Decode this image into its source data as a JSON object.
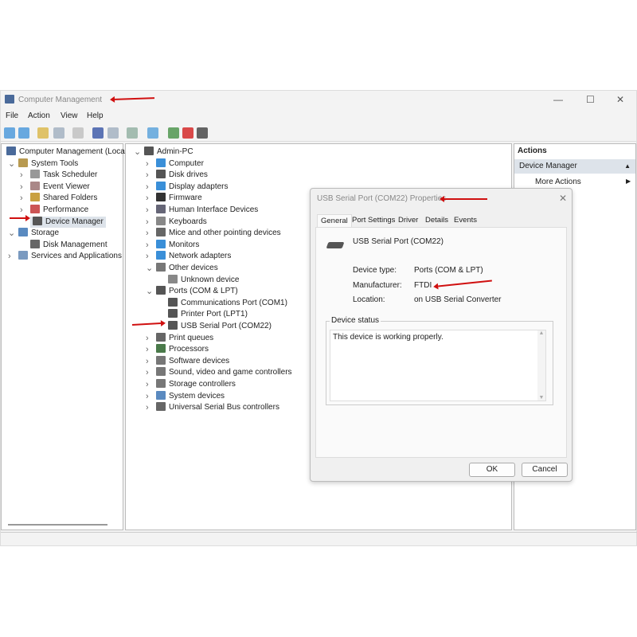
{
  "window": {
    "title": "Computer Management",
    "minimize": "—",
    "maximize": "☐",
    "close": "✕"
  },
  "menu": [
    "File",
    "Action",
    "View",
    "Help"
  ],
  "toolbar_icons": [
    "back-arrow-icon",
    "forward-arrow-icon",
    "up-folder-icon",
    "show-hide-tree-icon",
    "properties-icon",
    "help-icon",
    "show-action-pane-icon",
    "scan-hardware-icon",
    "monitor-icon",
    "enable-device-icon",
    "uninstall-icon",
    "update-driver-icon"
  ],
  "left_tree": [
    {
      "label": "Computer Management (Local",
      "level": 0,
      "chev": ""
    },
    {
      "label": "System Tools",
      "level": 1,
      "chev": "v"
    },
    {
      "label": "Task Scheduler",
      "level": 2,
      "chev": ">"
    },
    {
      "label": "Event Viewer",
      "level": 2,
      "chev": ">"
    },
    {
      "label": "Shared Folders",
      "level": 2,
      "chev": ">"
    },
    {
      "label": "Performance",
      "level": 2,
      "chev": ">"
    },
    {
      "label": "Device Manager",
      "level": 2,
      "chev": "",
      "selected": true
    },
    {
      "label": "Storage",
      "level": 1,
      "chev": "v"
    },
    {
      "label": "Disk Management",
      "level": 2,
      "chev": ""
    },
    {
      "label": "Services and Applications",
      "level": 1,
      "chev": ">"
    }
  ],
  "device_tree": [
    {
      "label": "Admin-PC",
      "level": 0,
      "chev": "v"
    },
    {
      "label": "Computer",
      "level": 1,
      "chev": ">"
    },
    {
      "label": "Disk drives",
      "level": 1,
      "chev": ">"
    },
    {
      "label": "Display adapters",
      "level": 1,
      "chev": ">"
    },
    {
      "label": "Firmware",
      "level": 1,
      "chev": ">"
    },
    {
      "label": "Human Interface Devices",
      "level": 1,
      "chev": ">"
    },
    {
      "label": "Keyboards",
      "level": 1,
      "chev": ">"
    },
    {
      "label": "Mice and other pointing devices",
      "level": 1,
      "chev": ">"
    },
    {
      "label": "Monitors",
      "level": 1,
      "chev": ">"
    },
    {
      "label": "Network adapters",
      "level": 1,
      "chev": ">"
    },
    {
      "label": "Other devices",
      "level": 1,
      "chev": "v"
    },
    {
      "label": "Unknown device",
      "level": 2,
      "chev": ""
    },
    {
      "label": "Ports (COM & LPT)",
      "level": 1,
      "chev": "v"
    },
    {
      "label": "Communications Port (COM1)",
      "level": 2,
      "chev": ""
    },
    {
      "label": "Printer Port (LPT1)",
      "level": 2,
      "chev": ""
    },
    {
      "label": "USB Serial Port (COM22)",
      "level": 2,
      "chev": ""
    },
    {
      "label": "Print queues",
      "level": 1,
      "chev": ">"
    },
    {
      "label": "Processors",
      "level": 1,
      "chev": ">"
    },
    {
      "label": "Software devices",
      "level": 1,
      "chev": ">"
    },
    {
      "label": "Sound, video and game controllers",
      "level": 1,
      "chev": ">"
    },
    {
      "label": "Storage controllers",
      "level": 1,
      "chev": ">"
    },
    {
      "label": "System devices",
      "level": 1,
      "chev": ">"
    },
    {
      "label": "Universal Serial Bus controllers",
      "level": 1,
      "chev": ">"
    }
  ],
  "actions": {
    "header": "Actions",
    "section": "Device Manager",
    "more": "More Actions"
  },
  "dialog": {
    "title": "USB Serial Port (COM22) Properties",
    "close": "✕",
    "tabs": [
      "General",
      "Port Settings",
      "Driver",
      "Details",
      "Events"
    ],
    "active_tab": "General",
    "device_name": "USB Serial Port (COM22)",
    "fields": [
      {
        "label": "Device type:",
        "value": "Ports (COM & LPT)"
      },
      {
        "label": "Manufacturer:",
        "value": "FTDI"
      },
      {
        "label": "Location:",
        "value": "on USB Serial Converter"
      }
    ],
    "status_group": "Device status",
    "status_text": "This device is working properly.",
    "ok": "OK",
    "cancel": "Cancel"
  },
  "colors": {
    "annotation_arrow": "#d01010",
    "selection": "#dde3ea",
    "accent": "#1e6fc8"
  }
}
